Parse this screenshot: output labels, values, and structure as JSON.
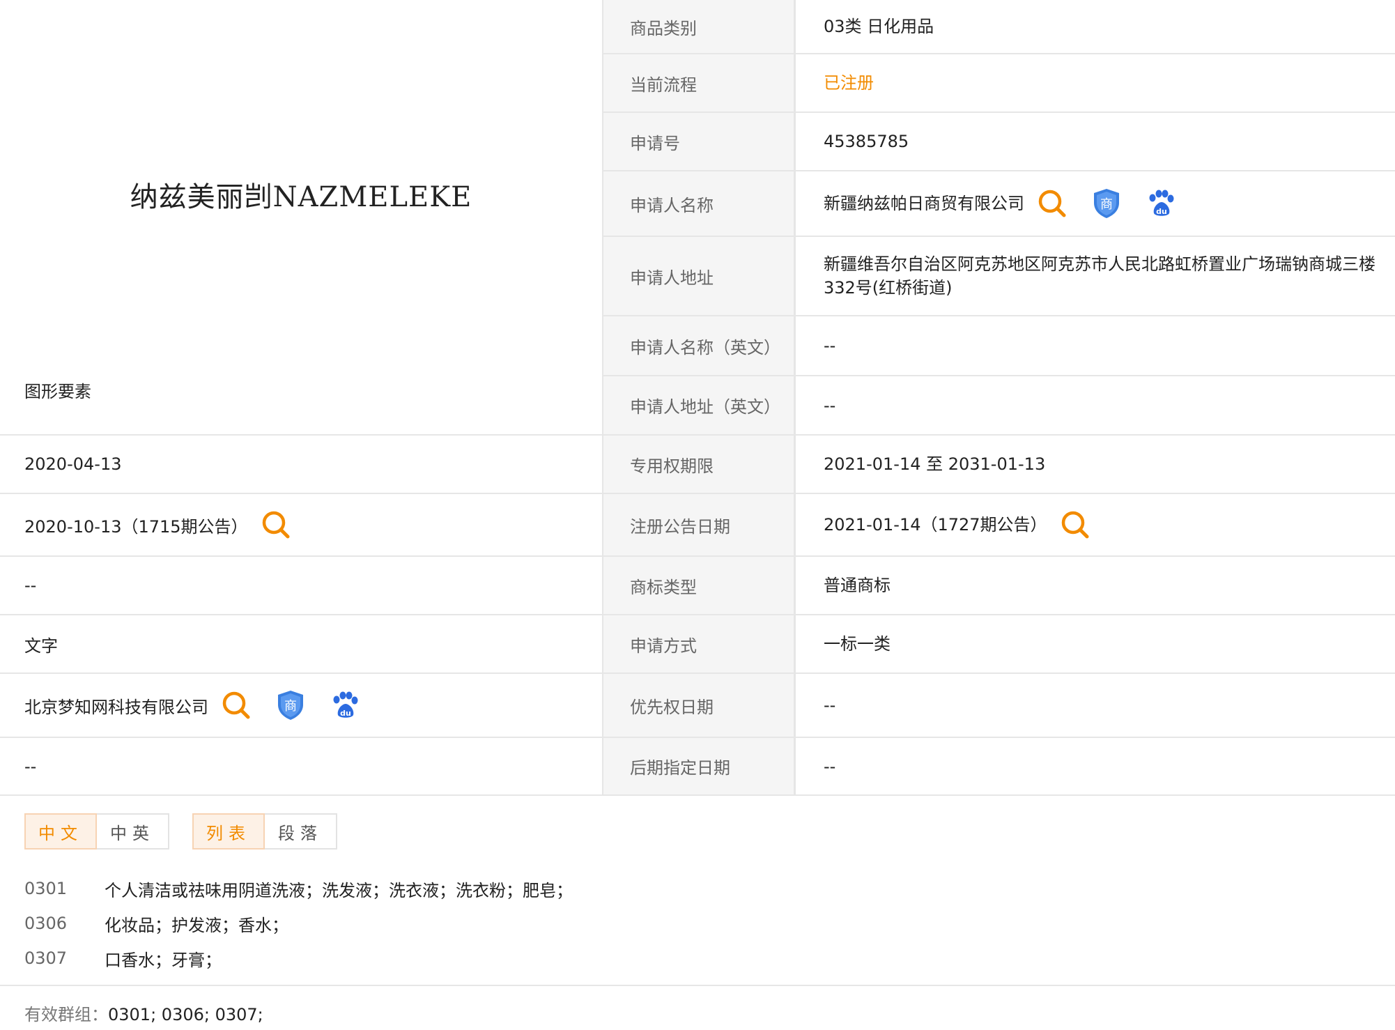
{
  "trademark": {
    "name": "纳兹美丽剀NAZMELEKE",
    "graphic_label": "图形要素"
  },
  "left_rows": [
    {
      "value": "2020-04-13"
    },
    {
      "value": "2020-10-13（1715期公告）"
    },
    {
      "value": "--"
    },
    {
      "value": "文字"
    },
    {
      "value": "北京梦知网科技有限公司"
    },
    {
      "value": "--"
    }
  ],
  "right_rows": [
    {
      "label": "商品类别",
      "value": "03类 日化用品"
    },
    {
      "label": "当前流程",
      "value": "已注册"
    },
    {
      "label": "申请号",
      "value": "45385785"
    },
    {
      "label": "申请人名称",
      "value": "新疆纳兹帕日商贸有限公司"
    },
    {
      "label": "申请人地址",
      "value": "新疆维吾尔自治区阿克苏地区阿克苏市人民北路虹桥置业广场瑞钠商城三楼332号(红桥街道)"
    },
    {
      "label": "申请人名称（英文）",
      "value": "--"
    },
    {
      "label": "申请人地址（英文）",
      "value": "--"
    },
    {
      "label": "专用权期限",
      "value": "2021-01-14 至 2031-01-13"
    },
    {
      "label": "注册公告日期",
      "value": "2021-01-14（1727期公告）"
    },
    {
      "label": "商标类型",
      "value": "普通商标"
    },
    {
      "label": "申请方式",
      "value": "一标一类"
    },
    {
      "label": "优先权日期",
      "value": "--"
    },
    {
      "label": "后期指定日期",
      "value": "--"
    }
  ],
  "tabs": {
    "lang": [
      "中文",
      "中英"
    ],
    "view": [
      "列表",
      "段落"
    ]
  },
  "goods": [
    {
      "code": "0301",
      "items": "个人清洁或祛味用阴道洗液；洗发液；洗衣液；洗衣粉；肥皂；"
    },
    {
      "code": "0306",
      "items": "化妆品；护发液；香水；"
    },
    {
      "code": "0307",
      "items": "口香水；牙膏；"
    }
  ],
  "groups": {
    "label": "有效群组：",
    "value": "0301;   0306;   0307;"
  },
  "icons": {
    "search": "search-icon",
    "trademark": "shang-shield-icon",
    "baidu": "baidu-paw-icon"
  },
  "colors": {
    "accent": "#f28b00",
    "shield": "#3a7fe0",
    "baidu": "#2c6be0",
    "label_bg": "#f5f5f5",
    "border": "#e6e6e6"
  }
}
